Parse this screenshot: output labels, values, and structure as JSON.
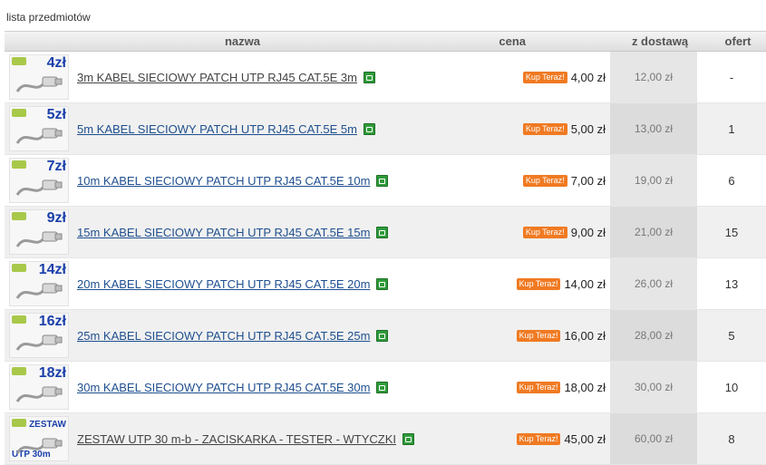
{
  "caption": "lista przedmiotów",
  "columns": {
    "name": "nazwa",
    "price": "cena",
    "delivery": "z dostawą",
    "offers": "ofert"
  },
  "buy_now_label": "Kup Teraz!",
  "accent_colors": {
    "buy_now": "#f07a22",
    "price_badge": "#1a3faa",
    "link": "#1f4f8f"
  },
  "items": [
    {
      "badge": "4zł",
      "title": "3m KABEL SIECIOWY PATCH UTP RJ45 CAT.5E 3m",
      "price": "4,00 zł",
      "delivery": "12,00 zł",
      "offers": "-",
      "linked": false
    },
    {
      "badge": "5zł",
      "title": "5m KABEL SIECIOWY PATCH UTP RJ45 CAT.5E 5m",
      "price": "5,00 zł",
      "delivery": "13,00 zł",
      "offers": "1",
      "linked": true
    },
    {
      "badge": "7zł",
      "title": "10m KABEL SIECIOWY PATCH UTP RJ45 CAT.5E 10m",
      "price": "7,00 zł",
      "delivery": "19,00 zł",
      "offers": "6",
      "linked": true
    },
    {
      "badge": "9zł",
      "title": "15m KABEL SIECIOWY PATCH UTP RJ45 CAT.5E 15m",
      "price": "9,00 zł",
      "delivery": "21,00 zł",
      "offers": "15",
      "linked": true
    },
    {
      "badge": "14zł",
      "title": "20m KABEL SIECIOWY PATCH UTP RJ45 CAT.5E 20m",
      "price": "14,00 zł",
      "delivery": "26,00 zł",
      "offers": "13",
      "linked": true
    },
    {
      "badge": "16zł",
      "title": "25m KABEL SIECIOWY PATCH UTP RJ45 CAT.5E 25m",
      "price": "16,00 zł",
      "delivery": "28,00 zł",
      "offers": "5",
      "linked": true
    },
    {
      "badge": "18zł",
      "title": "30m KABEL SIECIOWY PATCH UTP RJ45 CAT.5E 30m",
      "price": "18,00 zł",
      "delivery": "30,00 zł",
      "offers": "10",
      "linked": true
    },
    {
      "badge": "ZESTAW",
      "sub_badge": "UTP 30m",
      "title": "ZESTAW UTP 30 m-b - ZACISKARKA - TESTER - WTYCZKI",
      "price": "45,00 zł",
      "delivery": "60,00 zł",
      "offers": "8",
      "linked": false
    }
  ]
}
